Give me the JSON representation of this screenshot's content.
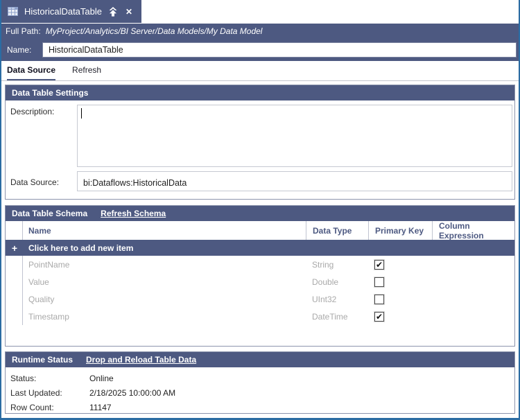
{
  "window": {
    "tab_title": "HistoricalDataTable",
    "full_path_label": "Full Path:",
    "full_path": "MyProject/Analytics/BI Server/Data Models/My Data Model",
    "name_label": "Name:",
    "name_value": "HistoricalDataTable"
  },
  "icons": {
    "tab_icon": "table-grid-icon",
    "promote_icon": "up-arrow-icon",
    "close_glyph": "✕",
    "add_glyph": "+",
    "check_glyph": "✔"
  },
  "tabs": [
    {
      "label": "Data Source",
      "active": true
    },
    {
      "label": "Refresh",
      "active": false
    }
  ],
  "settings": {
    "title": "Data Table Settings",
    "description_label": "Description:",
    "description_value": "",
    "data_source_label": "Data Source:",
    "data_source_value": "bi:Dataflows:HistoricalData"
  },
  "schema": {
    "title": "Data Table Schema",
    "refresh_link": "Refresh Schema",
    "add_row_label": "Click here to add new item",
    "columns": [
      "Name",
      "Data Type",
      "Primary Key",
      "Column Expression"
    ],
    "rows": [
      {
        "name": "PointName",
        "data_type": "String",
        "primary_key": true,
        "column_expression": ""
      },
      {
        "name": "Value",
        "data_type": "Double",
        "primary_key": false,
        "column_expression": ""
      },
      {
        "name": "Quality",
        "data_type": "UInt32",
        "primary_key": false,
        "column_expression": ""
      },
      {
        "name": "Timestamp",
        "data_type": "DateTime",
        "primary_key": true,
        "column_expression": ""
      }
    ]
  },
  "runtime": {
    "title": "Runtime Status",
    "reload_link": "Drop and Reload Table Data",
    "fields": [
      {
        "label": "Status:",
        "value": "Online"
      },
      {
        "label": "Last Updated:",
        "value": "2/18/2025 10:00:00 AM"
      },
      {
        "label": "Row Count:",
        "value": "11147"
      }
    ]
  },
  "colors": {
    "accent_slate": "#4d5981",
    "window_border": "#2b6ca3",
    "disabled_text": "#a9a9a9"
  }
}
